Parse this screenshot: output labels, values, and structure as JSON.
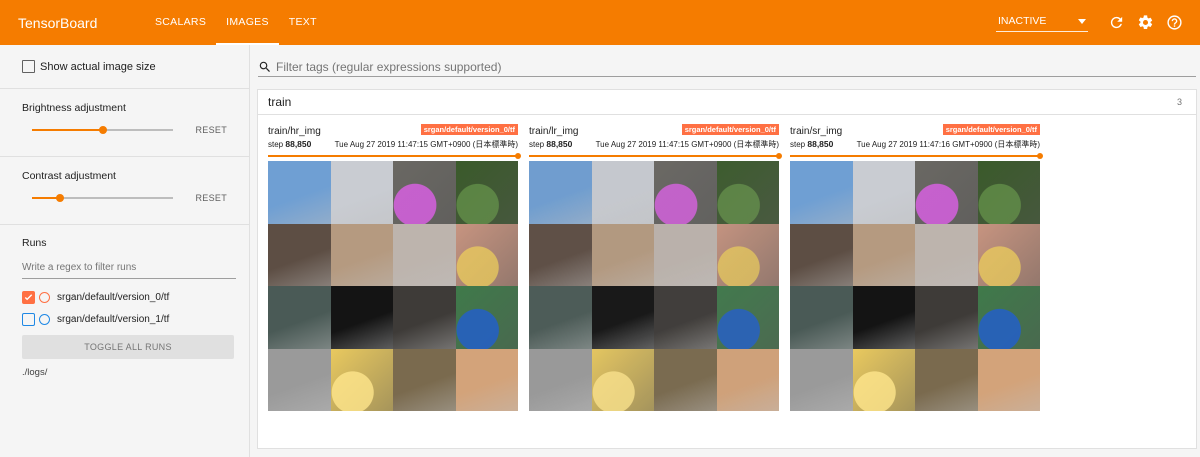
{
  "header": {
    "title": "TensorBoard",
    "tabs": [
      {
        "label": "SCALARS",
        "active": false
      },
      {
        "label": "IMAGES",
        "active": true
      },
      {
        "label": "TEXT",
        "active": false
      }
    ],
    "status_value": "INACTIVE",
    "icons": [
      "refresh-icon",
      "settings-icon",
      "help-icon"
    ]
  },
  "sidebar": {
    "show_actual_size_label": "Show actual image size",
    "brightness": {
      "label": "Brightness adjustment",
      "reset_label": "RESET",
      "value": 0.5
    },
    "contrast": {
      "label": "Contrast adjustment",
      "reset_label": "RESET",
      "value": 0.2
    },
    "runs": {
      "title": "Runs",
      "filter_placeholder": "Write a regex to filter runs",
      "items": [
        {
          "label": "srgan/default/version_0/tf",
          "checked": true,
          "color": "#ff7043"
        },
        {
          "label": "srgan/default/version_1/tf",
          "checked": false,
          "color": "#1e88e5"
        }
      ],
      "toggle_label": "TOGGLE ALL RUNS",
      "logdir": "./logs/"
    }
  },
  "main": {
    "search_placeholder": "Filter tags (regular expressions supported)",
    "panel": {
      "title": "train",
      "count": "3",
      "cards": [
        {
          "tag": "train/hr_img",
          "run": "srgan/default/version_0/tf",
          "step_label": "step",
          "step": "88,850",
          "time": "Tue Aug 27 2019 11:47:15 GMT+0900 (日本標準時)"
        },
        {
          "tag": "train/lr_img",
          "run": "srgan/default/version_0/tf",
          "step_label": "step",
          "step": "88,850",
          "time": "Tue Aug 27 2019 11:47:15 GMT+0900 (日本標準時)"
        },
        {
          "tag": "train/sr_img",
          "run": "srgan/default/version_0/tf",
          "step_label": "step",
          "step": "88,850",
          "time": "Tue Aug 27 2019 11:47:16 GMT+0900 (日本標準時)"
        }
      ]
    }
  },
  "colors": {
    "accent": "#f57c00",
    "run_badge": "#ff7043"
  }
}
